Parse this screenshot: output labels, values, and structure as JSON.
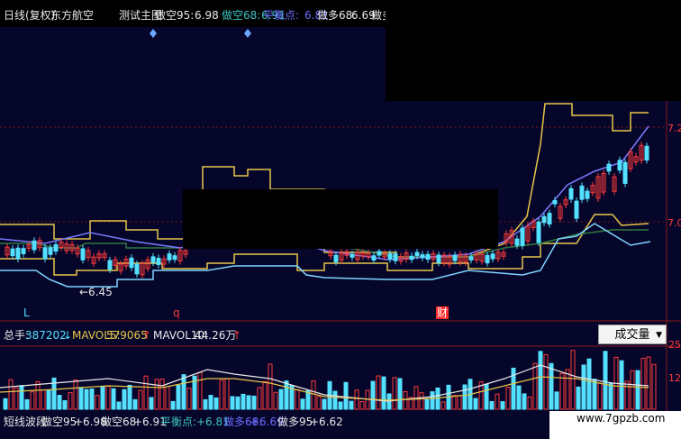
{
  "header": {
    "period": "日线(复权)",
    "stock": "东方航空",
    "indicator_name": "测试主图",
    "items": [
      {
        "label": "做空95:",
        "value": "6.98",
        "color": "#e8e8e8"
      },
      {
        "label": "做空68:",
        "value": "6.91",
        "color": "#3fc4c0"
      },
      {
        "label": "平衡点:",
        "value": "6.81",
        "color": "#6a6aff"
      },
      {
        "label": "做多68:",
        "value": "6.69",
        "color": "#e8e8e8"
      },
      {
        "label": "做多",
        "value": "",
        "color": "#e8e8e8"
      }
    ]
  },
  "main_chart": {
    "low_label": "←6.45",
    "marker_l": "L",
    "marker_q": "q",
    "marker_cai": "财",
    "price_axis": [
      "7.2",
      "7.0"
    ]
  },
  "volume_panel": {
    "total_label": "总手:",
    "total_value": "387202",
    "total_arrow": "↓",
    "mavol5_label": "MAVOL5:",
    "mavol5_value": "579065",
    "mavol5_arrow": "↑",
    "mavol10_label": "MAVOL10:",
    "mavol10_value": "44.26万",
    "mavol10_arrow": "↑",
    "selector_value": "成交量",
    "axis": [
      "25",
      "12"
    ]
  },
  "bottom_bar": {
    "title": "短线波段",
    "items": [
      {
        "label": "做空95:",
        "value": "+6.98",
        "color": "#e8e8e8"
      },
      {
        "label": "做空68:",
        "value": "+6.91",
        "color": "#e8e8e8"
      },
      {
        "label": "平衡点:",
        "value": "+6.81",
        "color": "#3fc4c0"
      },
      {
        "label": "做多68:",
        "value": "+6.69",
        "color": "#6a6aff"
      },
      {
        "label": "做多95:",
        "value": "+6.62",
        "color": "#e8e8e8"
      }
    ]
  },
  "watermark": "www.7gpzb.com",
  "colors": {
    "background": "#0a0a2a",
    "up": "#ff3b3b",
    "down": "#54e0ff",
    "band_outer": "#e6c64a",
    "band_inner_low": "#7fd4ff",
    "ma": "#7a7aff",
    "grid": "#8a1a1a"
  }
}
